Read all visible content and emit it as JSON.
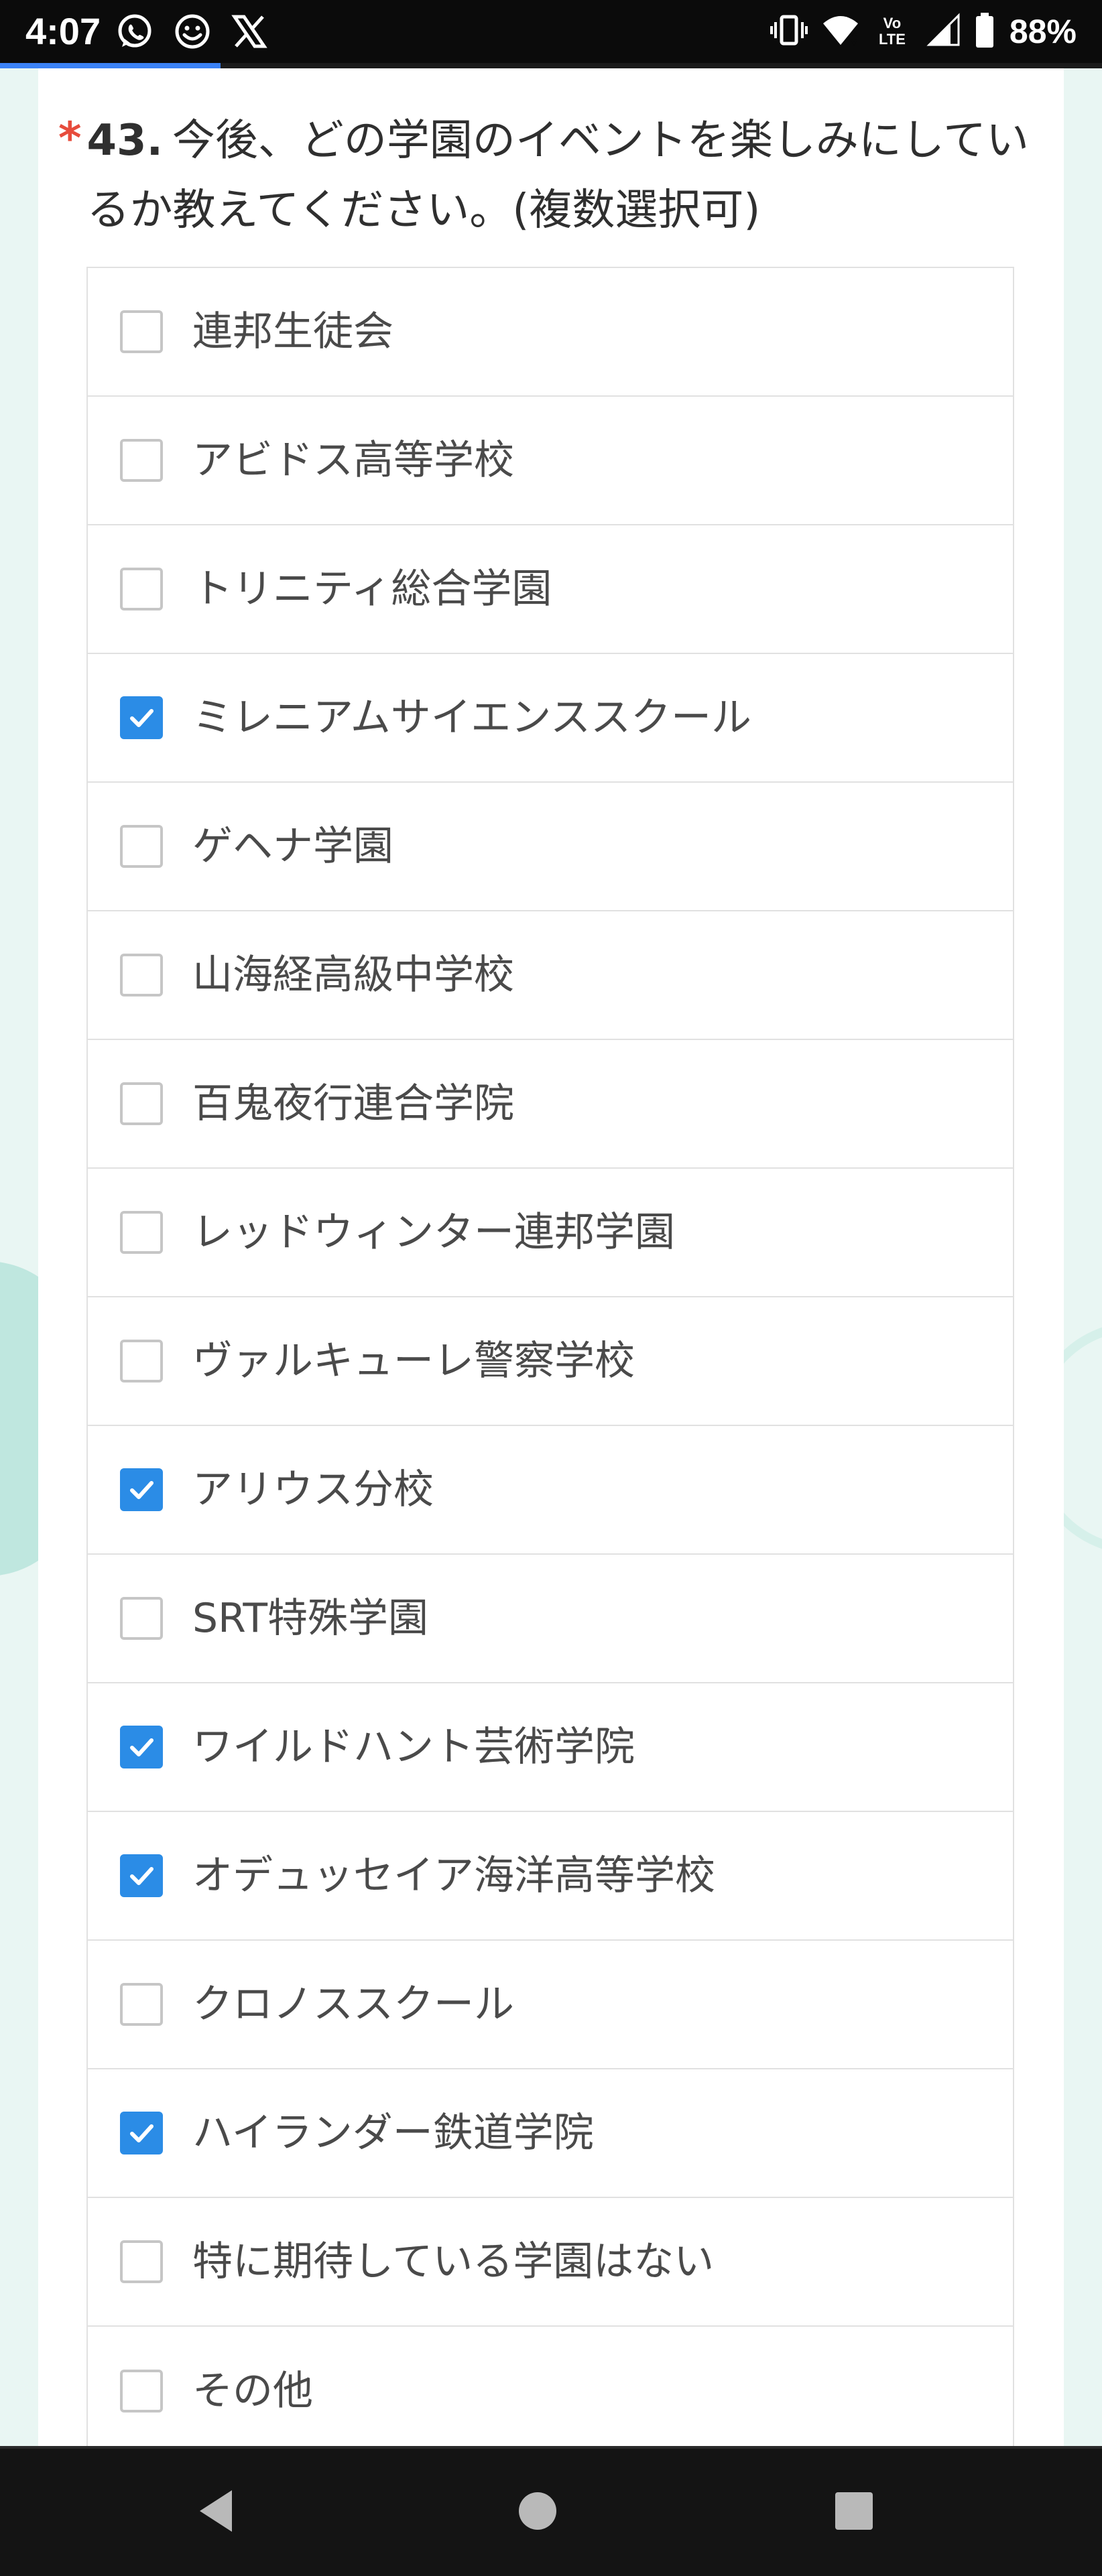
{
  "status_bar": {
    "time": "4:07",
    "notification_icons": [
      "whatsapp-icon",
      "smiley-icon",
      "x-logo-icon"
    ],
    "volte": "Vo LTE",
    "battery_percent": "88%",
    "battery_level": 0.88
  },
  "form": {
    "progress_fraction": 0.2,
    "accent_color": "#2b8ce6",
    "required_color": "#e74c3c"
  },
  "question": {
    "required_mark": "*",
    "number": "43.",
    "text": "今後、どの学園のイベントを楽しみにしているか教えてください。(複数選択可)"
  },
  "options": [
    {
      "label": "連邦生徒会",
      "checked": false
    },
    {
      "label": "アビドス高等学校",
      "checked": false
    },
    {
      "label": "トリニティ総合学園",
      "checked": false
    },
    {
      "label": "ミレニアムサイエンススクール",
      "checked": true
    },
    {
      "label": "ゲヘナ学園",
      "checked": false
    },
    {
      "label": "山海経高級中学校",
      "checked": false
    },
    {
      "label": "百鬼夜行連合学院",
      "checked": false
    },
    {
      "label": "レッドウィンター連邦学園",
      "checked": false
    },
    {
      "label": "ヴァルキューレ警察学校",
      "checked": false
    },
    {
      "label": "アリウス分校",
      "checked": true
    },
    {
      "label": "SRT特殊学園",
      "checked": false
    },
    {
      "label": "ワイルドハント芸術学院",
      "checked": true
    },
    {
      "label": "オデュッセイア海洋高等学校",
      "checked": true
    },
    {
      "label": "クロノススクール",
      "checked": false
    },
    {
      "label": "ハイランダー鉄道学院",
      "checked": true
    },
    {
      "label": "特に期待している学園はない",
      "checked": false
    },
    {
      "label": "その他",
      "checked": false
    }
  ],
  "nav_bar": {
    "buttons": [
      "back-icon",
      "home-icon",
      "recents-icon"
    ]
  }
}
